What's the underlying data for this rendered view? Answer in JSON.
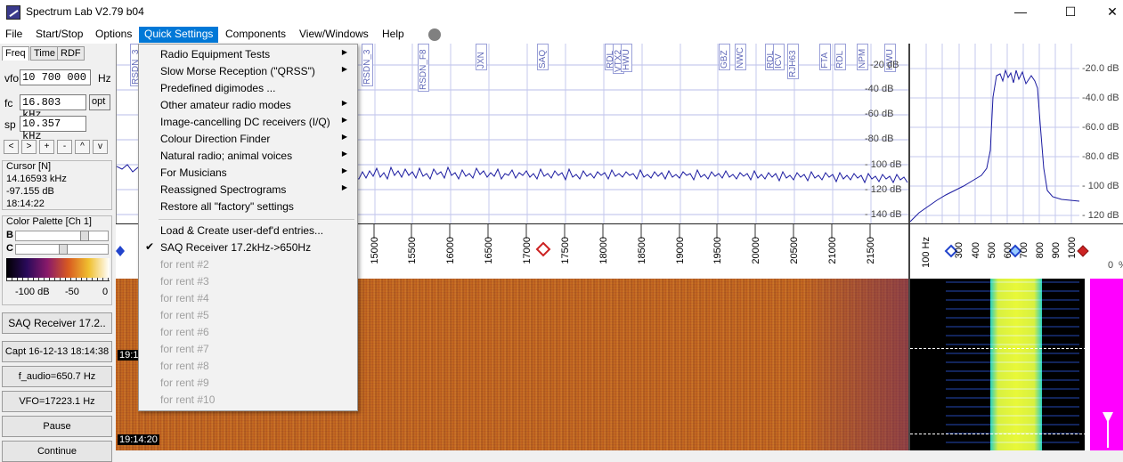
{
  "window": {
    "title": "Spectrum Lab V2.79 b04",
    "min_glyph": "—",
    "max_glyph": "☐",
    "close_glyph": "✕"
  },
  "menubar": {
    "items": [
      "File",
      "Start/Stop",
      "Options",
      "Quick Settings",
      "Components",
      "View/Windows",
      "Help"
    ]
  },
  "left_panel": {
    "tabs": [
      "Freq",
      "Time",
      "RDF"
    ],
    "vfo_label": "vfo",
    "vfo_value": "10 700 000",
    "vfo_unit": "Hz",
    "fc_label": "fc",
    "fc_value": "16.803 kHz",
    "opt_label": "opt",
    "sp_label": "sp",
    "sp_value": "10.357 kHz",
    "nav_buttons": [
      "<",
      ">",
      "+",
      "-",
      "^",
      "v"
    ],
    "cursor_title": "Cursor [N]",
    "cursor_freq": "14.16593 kHz",
    "cursor_db": "-97.155 dB",
    "cursor_time": "18:14:22",
    "palette_title": "Color Palette [Ch 1]",
    "palette_b": "B",
    "palette_c": "C",
    "palette_scale": [
      "-100 dB",
      "-50",
      "0"
    ],
    "buttons": [
      "SAQ Receiver 17.2..",
      "Capt 16-12-13 18:14:38",
      "f_audio=650.7 Hz",
      "VFO=17223.1 Hz",
      "Pause",
      "Continue"
    ]
  },
  "spectrum": {
    "db_labels": [
      "-20 dB",
      "-40 dB",
      "-60 dB",
      "-80 dB",
      "- 100 dB",
      "- 120 dB",
      "- 140 dB"
    ],
    "markers": [
      "RSDN_3",
      "RSDN_F8",
      "JXN",
      "SAQ",
      "RDL",
      "VTX2",
      "HWU",
      "GBZ",
      "NWC",
      "RDL",
      "ICV",
      "RJH63",
      "FTA",
      "RDL",
      "NPM",
      "HWU"
    ],
    "freq_ticks": [
      "15000",
      "15500",
      "16000",
      "16500",
      "17000",
      "17500",
      "18000",
      "18500",
      "19000",
      "19500",
      "20000",
      "20500",
      "21000",
      "21500"
    ]
  },
  "waterfall": {
    "timestamps": [
      "19:1",
      "19:14:20"
    ]
  },
  "right_spectrum": {
    "db_labels": [
      "-20.0 dB",
      "-40.0 dB",
      "-60.0 dB",
      "-80.0 dB",
      "- 100 dB",
      "- 120 dB"
    ],
    "freq_ticks": [
      "100 Hz",
      "300",
      "400",
      "500",
      "600",
      "700",
      "800",
      "900",
      "1000"
    ],
    "bar_labels": [
      "0",
      "%"
    ]
  },
  "quick_settings_menu": {
    "items": [
      {
        "label": "Radio Equipment Tests",
        "submenu": true
      },
      {
        "label": "Slow Morse Reception (\"QRSS\")",
        "submenu": true
      },
      {
        "label": "Predefined digimodes ...",
        "submenu": false
      },
      {
        "label": "Other amateur radio modes",
        "submenu": true
      },
      {
        "label": "Image-cancelling DC receivers (I/Q)",
        "submenu": true
      },
      {
        "label": "Colour Direction Finder",
        "submenu": true
      },
      {
        "label": "Natural radio;  animal voices",
        "submenu": true
      },
      {
        "label": "For Musicians",
        "submenu": true
      },
      {
        "label": "Reassigned Spectrograms",
        "submenu": true
      },
      {
        "label": "Restore all \"factory\" settings",
        "submenu": false
      }
    ],
    "user_items": [
      {
        "label": "Load & Create user-def'd entries...",
        "checked": false,
        "disabled": false
      },
      {
        "label": "SAQ Receiver 17.2kHz->650Hz",
        "checked": true,
        "disabled": false
      },
      {
        "label": "for rent #2",
        "checked": false,
        "disabled": true
      },
      {
        "label": "for rent #3",
        "checked": false,
        "disabled": true
      },
      {
        "label": "for rent #4",
        "checked": false,
        "disabled": true
      },
      {
        "label": "for rent #5",
        "checked": false,
        "disabled": true
      },
      {
        "label": "for rent #6",
        "checked": false,
        "disabled": true
      },
      {
        "label": "for rent #7",
        "checked": false,
        "disabled": true
      },
      {
        "label": "for rent #8",
        "checked": false,
        "disabled": true
      },
      {
        "label": "for rent #9",
        "checked": false,
        "disabled": true
      },
      {
        "label": "for rent #10",
        "checked": false,
        "disabled": true
      }
    ]
  },
  "colors": {
    "menu_active": "#0078d7",
    "trace": "#1a1aa0",
    "waterfall": "#c86a1c",
    "level_bar": "#ff00ff"
  }
}
